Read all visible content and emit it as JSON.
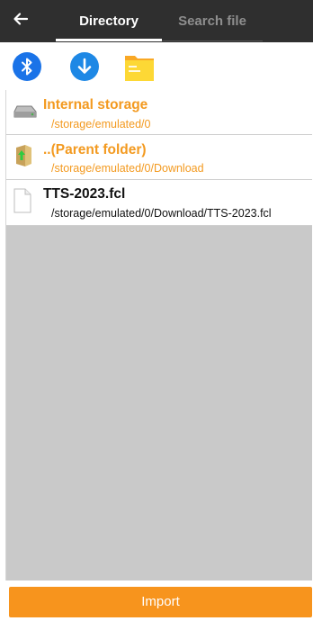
{
  "header": {
    "back_icon": "arrow-left-icon",
    "tabs": [
      {
        "label": "Directory",
        "active": true
      },
      {
        "label": "Search file",
        "active": false
      }
    ]
  },
  "toolbar": {
    "icons": [
      "bluetooth-icon",
      "download-icon",
      "folder-icon"
    ]
  },
  "files": [
    {
      "name": "Internal storage",
      "path": "/storage/emulated/0",
      "icon": "drive-icon"
    },
    {
      "name": "..(Parent folder)",
      "path": "/storage/emulated/0/Download",
      "icon": "parent-folder-icon"
    },
    {
      "name": "TTS-2023.fcl",
      "path": "/storage/emulated/0/Download/TTS-2023.fcl",
      "icon": "file-icon"
    }
  ],
  "footer": {
    "import_label": "Import"
  },
  "colors": {
    "header_bg": "#2f2f2f",
    "accent_orange": "#f7941d",
    "bluetooth_blue": "#1a73e8",
    "download_blue": "#1e88e5",
    "folder_yellow": "#fbc02d",
    "list_bg": "#c9c9c9"
  }
}
